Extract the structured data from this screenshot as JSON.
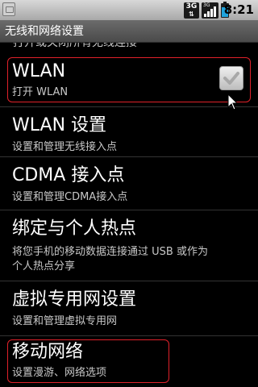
{
  "status_bar": {
    "network_badge": "3G",
    "signal_tag": "3G",
    "time": "8:21",
    "battery_color": "#1fa3dc",
    "icons": [
      "notification-icon",
      "data-3g-icon",
      "signal-icon",
      "battery-icon"
    ]
  },
  "title_bar": {
    "title": "无线和网络设置"
  },
  "settings": [
    {
      "title": "WLAN",
      "summary": "打开 WLAN",
      "checkbox": true,
      "checked": true
    },
    {
      "title": "WLAN 设置",
      "summary": "设置和管理无线接入点"
    },
    {
      "title": "CDMA 接入点",
      "summary": "设置和管理CDMA接入点"
    },
    {
      "title": "绑定与个人热点",
      "summary": "将您手机的移动数据连接通过 USB 或作为",
      "summary_line2": "个人热点分享"
    },
    {
      "title": "虚拟专用网设置",
      "summary": "设置和管理虚拟专用网"
    },
    {
      "title": "移动网络",
      "summary": "设置漫游、网络选项"
    }
  ],
  "highlight_color": "#e0212a"
}
